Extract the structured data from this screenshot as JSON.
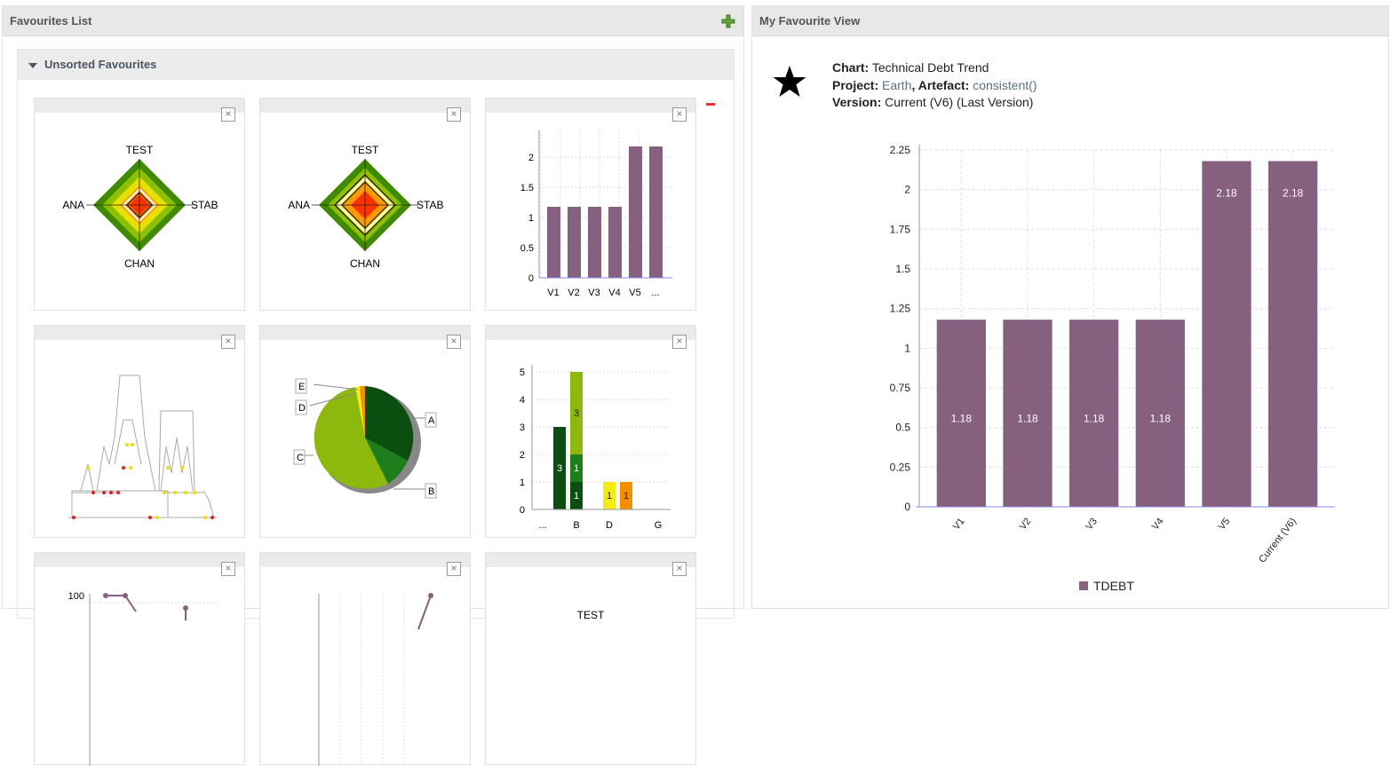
{
  "favourites": {
    "title": "Favourites List",
    "group_title": "Unsorted Favourites",
    "cards": {
      "kiviat": {
        "labels": [
          "TEST",
          "ANA",
          "STAB",
          "CHAN"
        ]
      },
      "mini_bar": {
        "yticks": [
          "0",
          "0.5",
          "1",
          "1.5",
          "2"
        ],
        "xticks": [
          "V1",
          "V2",
          "V3",
          "V4",
          "V5",
          "..."
        ]
      },
      "pie": {
        "labels": [
          "A",
          "B",
          "C",
          "D",
          "E"
        ]
      },
      "stacked": {
        "yticks": [
          "0",
          "1",
          "2",
          "3",
          "4",
          "5"
        ],
        "xticks": [
          "...",
          "B",
          "D",
          "G"
        ],
        "values": [
          "3",
          "3",
          "1",
          "1",
          "1",
          "1"
        ]
      },
      "line": {
        "ytick": "100"
      },
      "cropped_label": "TEST"
    },
    "close_glyph": "×"
  },
  "view": {
    "title": "My Favourite View",
    "chart_label": "Chart:",
    "chart_name": "Technical Debt Trend",
    "project_label": "Project:",
    "project_name": "Earth",
    "artefact_label": "Artefact:",
    "artefact_name": "consistent()",
    "version_label": "Version:",
    "version_value": "Current (V6) (Last Version)"
  },
  "colors": {
    "bar": "#86607f",
    "axis_line": "#8888dd"
  },
  "chart_data": {
    "type": "bar",
    "categories": [
      "V1",
      "V2",
      "V3",
      "V4",
      "V5",
      "Current (V6)"
    ],
    "series": [
      {
        "name": "TDEBT",
        "values": [
          1.18,
          1.18,
          1.18,
          1.18,
          2.18,
          2.18
        ]
      }
    ],
    "data_labels": [
      "1.18",
      "1.18",
      "1.18",
      "1.18",
      "2.18",
      "2.18"
    ],
    "yticks": [
      "0",
      "0.25",
      "0.5",
      "0.75",
      "1",
      "1.25",
      "1.5",
      "1.75",
      "2",
      "2.25"
    ],
    "ylim": [
      0,
      2.25
    ],
    "grid": true,
    "legend": "bottom"
  }
}
